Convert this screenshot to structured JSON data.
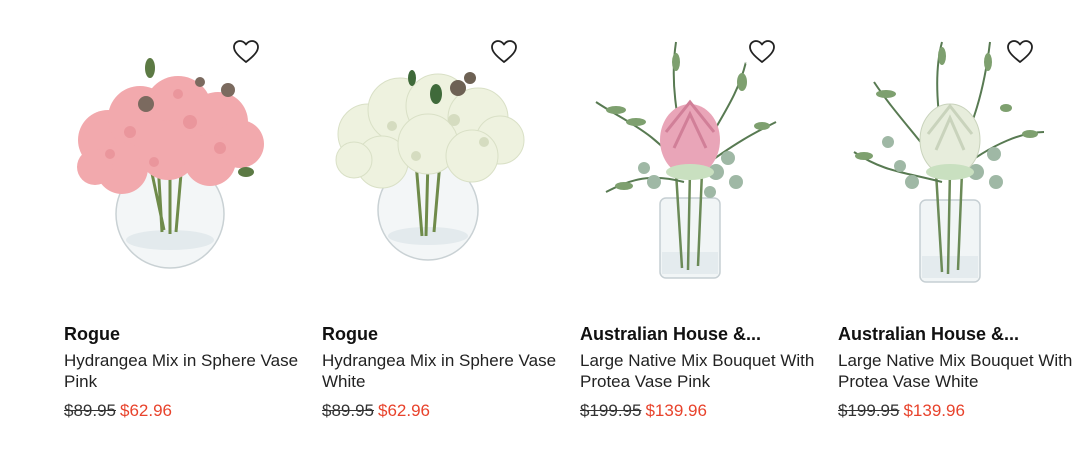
{
  "products": [
    {
      "brand": "Rogue",
      "name": "Hydrangea Mix in Sphere Vase Pink",
      "was_price": "$89.95",
      "price": "$62.96",
      "image_icon": "pink-hydrangea-sphere-vase",
      "flower_color": "#f2a9ad"
    },
    {
      "brand": "Rogue",
      "name": "Hydrangea Mix in Sphere Vase White",
      "was_price": "$89.95",
      "price": "$62.96",
      "image_icon": "white-hydrangea-sphere-vase",
      "flower_color": "#eef2df"
    },
    {
      "brand": "Australian House &...",
      "name": "Large Native Mix Bouquet With Protea Vase Pink",
      "was_price": "$199.95",
      "price": "$139.96",
      "image_icon": "pink-protea-cylinder-vase",
      "flower_color": "#e9a5b8"
    },
    {
      "brand": "Australian House &...",
      "name": "Large Native Mix Bouquet With Protea Vase White",
      "was_price": "$199.95",
      "price": "$139.96",
      "image_icon": "white-protea-cylinder-vase",
      "flower_color": "#e7eddc"
    }
  ],
  "colors": {
    "sale_price": "#e8432c",
    "text": "#222222"
  },
  "icons": {
    "wishlist": "heart-outline-icon"
  }
}
